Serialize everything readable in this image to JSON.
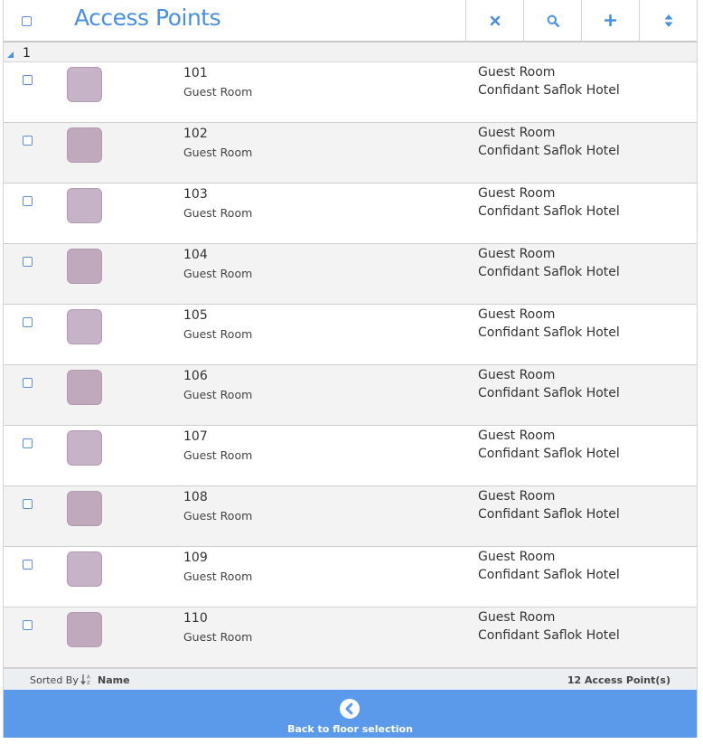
{
  "header": {
    "title": "Access Points",
    "tools": [
      {
        "name": "clear-button",
        "icon": "close-icon"
      },
      {
        "name": "search-button",
        "icon": "search-icon"
      },
      {
        "name": "add-button",
        "icon": "plus-icon"
      },
      {
        "name": "sort-button",
        "icon": "sort-icon"
      }
    ]
  },
  "group": {
    "label": "1"
  },
  "rows": [
    {
      "name": "101",
      "subtitle": "Guest Room",
      "type": "Guest Room",
      "hotel": "Confidant Saflok Hotel"
    },
    {
      "name": "102",
      "subtitle": "Guest Room",
      "type": "Guest Room",
      "hotel": "Confidant Saflok Hotel"
    },
    {
      "name": "103",
      "subtitle": "Guest Room",
      "type": "Guest Room",
      "hotel": "Confidant Saflok Hotel"
    },
    {
      "name": "104",
      "subtitle": "Guest Room",
      "type": "Guest Room",
      "hotel": "Confidant Saflok Hotel"
    },
    {
      "name": "105",
      "subtitle": "Guest Room",
      "type": "Guest Room",
      "hotel": "Confidant Saflok Hotel"
    },
    {
      "name": "106",
      "subtitle": "Guest Room",
      "type": "Guest Room",
      "hotel": "Confidant Saflok Hotel"
    },
    {
      "name": "107",
      "subtitle": "Guest Room",
      "type": "Guest Room",
      "hotel": "Confidant Saflok Hotel"
    },
    {
      "name": "108",
      "subtitle": "Guest Room",
      "type": "Guest Room",
      "hotel": "Confidant Saflok Hotel"
    },
    {
      "name": "109",
      "subtitle": "Guest Room",
      "type": "Guest Room",
      "hotel": "Confidant Saflok Hotel"
    },
    {
      "name": "110",
      "subtitle": "Guest Room",
      "type": "Guest Room",
      "hotel": "Confidant Saflok Hotel"
    }
  ],
  "footer": {
    "sorted_by_label": "Sorted By",
    "sort_field": "Name",
    "count": "12 Access Point(s)"
  },
  "back": {
    "label": "Back to floor selection",
    "icon": "chevron-left-circle-icon"
  },
  "colors": {
    "accent": "#4a90e2",
    "back_bar": "#5b9aea",
    "thumb": "#c7b3c7"
  }
}
